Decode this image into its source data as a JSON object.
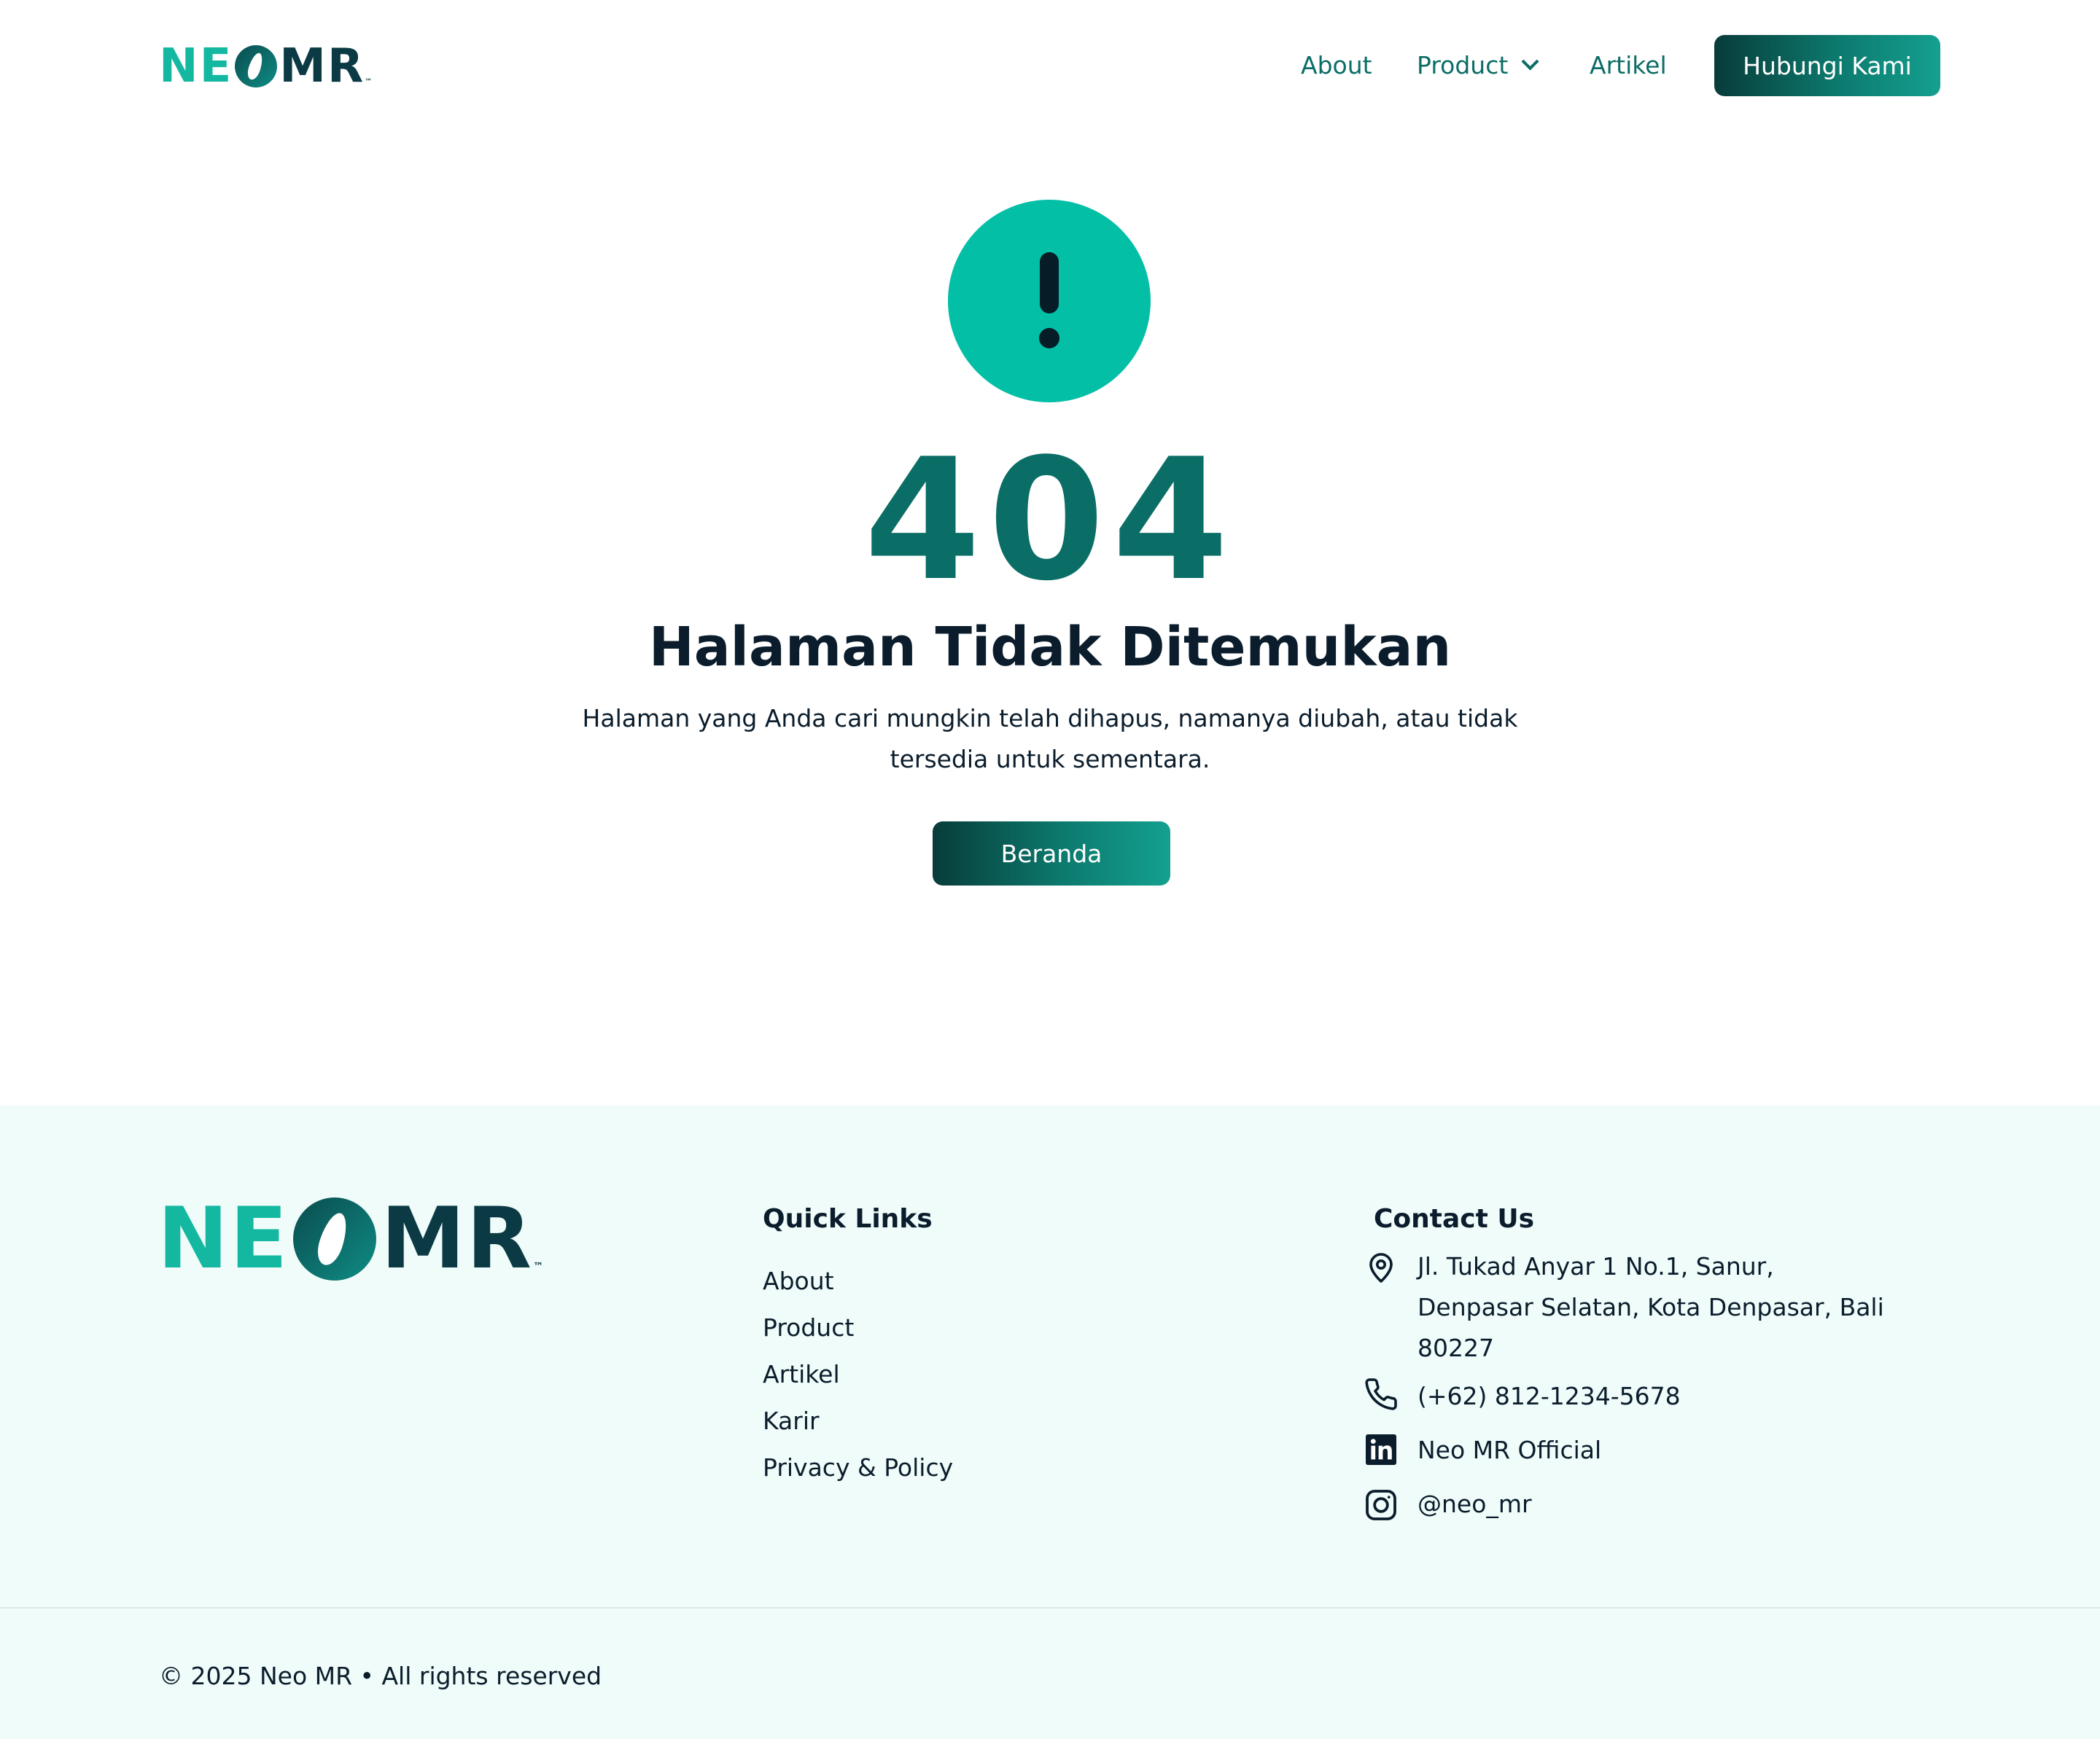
{
  "header": {
    "logo": {
      "part1": "NE",
      "part2": "MR",
      "tm": "™"
    },
    "nav": {
      "about": "About",
      "product": "Product",
      "artikel": "Artikel"
    },
    "cta_label": "Hubungi Kami"
  },
  "hero": {
    "code": "404",
    "title": "Halaman Tidak Ditemukan",
    "description": "Halaman yang Anda cari mungkin telah dihapus, namanya diubah, atau tidak tersedia untuk sementara.",
    "button_label": "Beranda"
  },
  "footer": {
    "logo": {
      "part1": "NE",
      "part2": "MR",
      "tm": "™"
    },
    "quick_links": {
      "title": "Quick Links",
      "items": [
        "About",
        "Product",
        "Artikel",
        "Karir",
        "Privacy & Policy"
      ]
    },
    "contact": {
      "title": "Contact Us",
      "address": "Jl. Tukad Anyar 1 No.1, Sanur, Denpasar Selatan, Kota Denpasar, Bali 80227",
      "phone": "(+62) 812-1234-5678",
      "linkedin": "Neo MR Official",
      "instagram": "@neo_mr"
    },
    "copyright": "© 2025 Neo MR • All rights reserved"
  },
  "colors": {
    "brand_teal": "#03bfa6",
    "brand_dark": "#0a6e67",
    "footer_bg": "#effcfa",
    "text": "#0b1d2c"
  },
  "icons": {
    "alert": "exclamation-icon",
    "dropdown": "chevron-down-icon",
    "address": "location-pin-icon",
    "phone": "phone-icon",
    "linkedin": "linkedin-icon",
    "instagram": "instagram-icon"
  }
}
